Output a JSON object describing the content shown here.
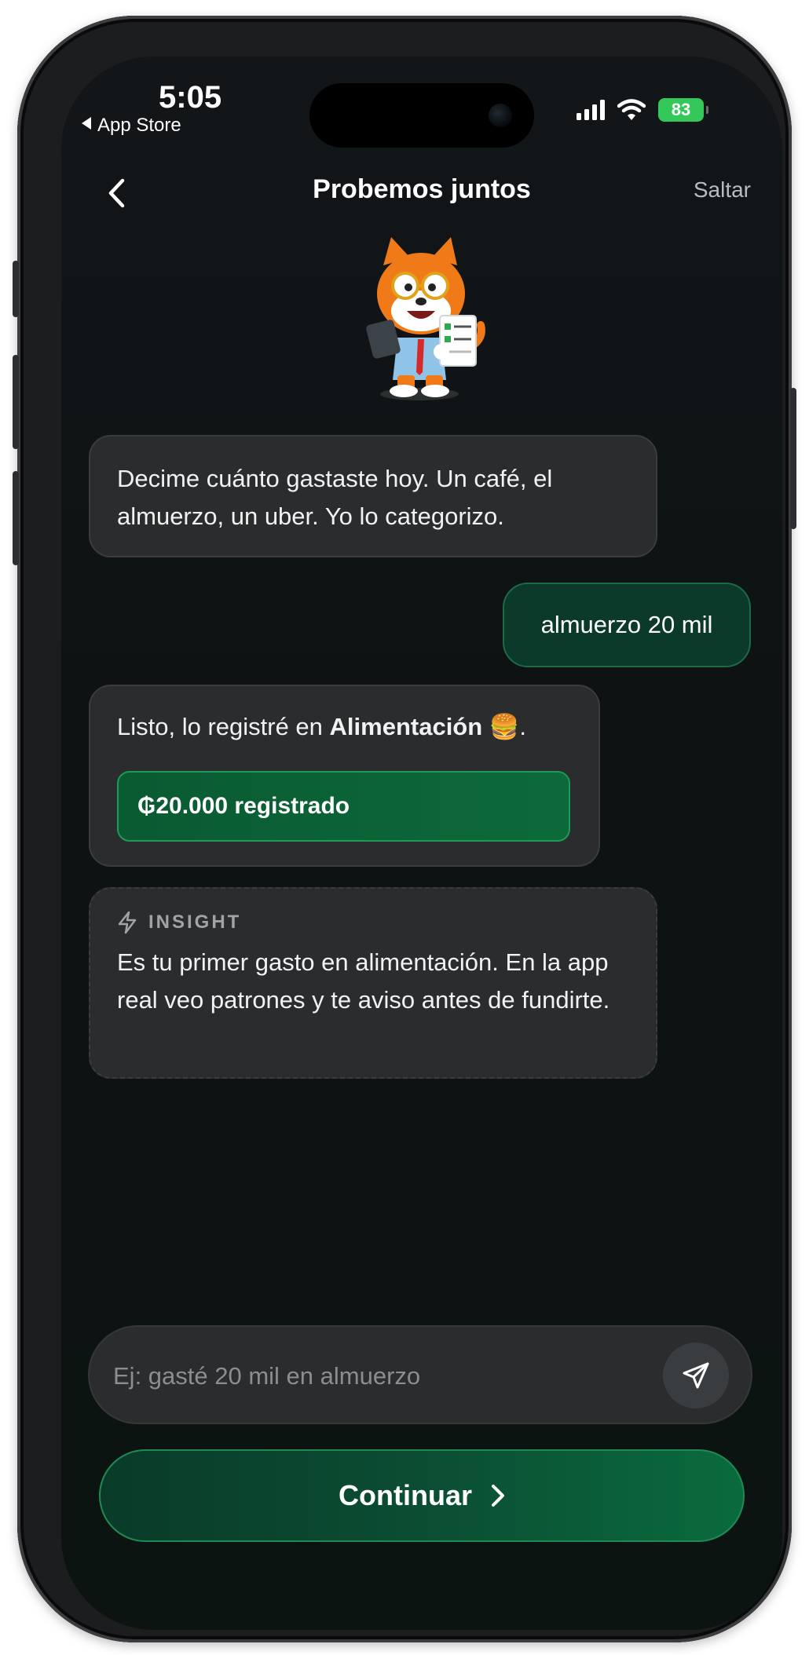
{
  "status_bar": {
    "time": "5:05",
    "back_app": "App Store",
    "battery": "83"
  },
  "nav": {
    "title": "Probemos juntos",
    "skip_label": "Saltar"
  },
  "chat": {
    "bot_message_1": "Decime cuánto gastaste hoy. Un café, el almuerzo, un uber. Yo lo categorizo.",
    "user_message_1": "almuerzo 20 mil",
    "bot_message_2_prefix": "Listo, lo registré en ",
    "bot_message_2_category": "Alimentación",
    "bot_message_2_suffix": " 🍔.",
    "recorded_chip": "₲20.000 registrado",
    "insight_label": "INSIGHT",
    "insight_text": "Es tu primer gasto en alimentación. En la app real veo patrones y te aviso antes de fundirte."
  },
  "composer": {
    "placeholder": "Ej: gasté 20 mil en almuerzo"
  },
  "cta": {
    "continue_label": "Continuar"
  },
  "colors": {
    "accent_green": "#0b4d33",
    "user_bubble": "#0b3a2a",
    "bot_bubble": "#2a2c2e"
  }
}
